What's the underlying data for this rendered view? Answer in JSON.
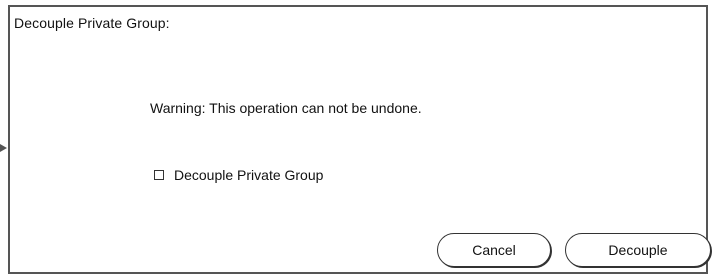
{
  "dialog": {
    "title": "Decouple Private Group:",
    "warning": "Warning:  This operation can not be undone.",
    "checkbox_label": "Decouple Private Group",
    "checkbox_checked": false,
    "cancel_label": "Cancel",
    "decouple_label": "Decouple"
  }
}
